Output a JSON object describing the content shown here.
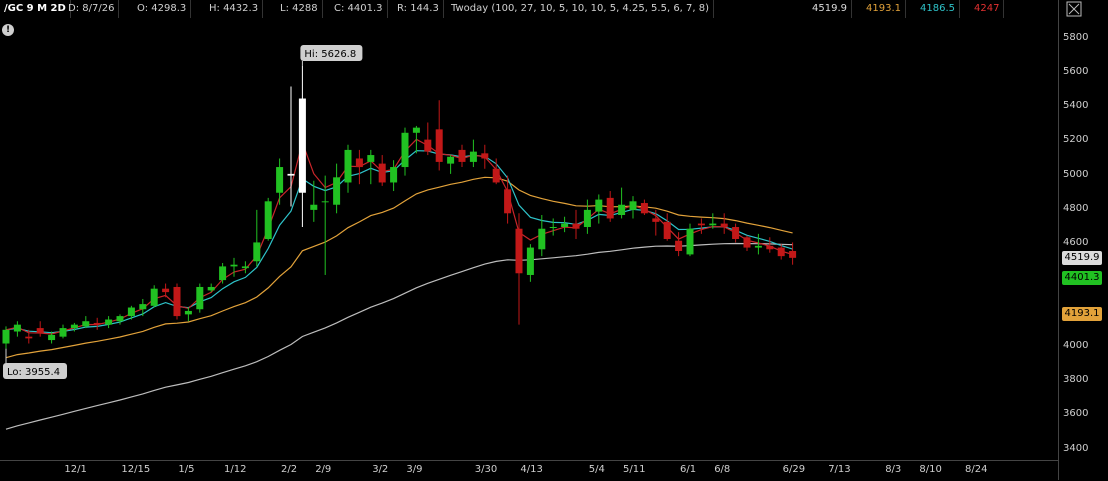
{
  "header": {
    "symbol": "/GC 9 M 2D",
    "date": "D: 8/7/26",
    "open": "O: 4298.3",
    "high": "H: 4432.3",
    "low": "L: 4288",
    "close": "C: 4401.3",
    "range": "R: 144.3",
    "study": "Twoday (100, 27, 10, 5, 10, 10, 5, 4.25, 5.5, 6, 7, 8)",
    "study_values": [
      "4519.9",
      "4193.1",
      "4186.5",
      "4247"
    ]
  },
  "colors": {
    "up": "#21c122",
    "down": "#c21818",
    "spike": "#ffffff",
    "ma_gray": "#bdbdbd",
    "ma_orange": "#e2a23a",
    "ma_cyan": "#2ec3c9",
    "ma_red": "#c9252a",
    "study_val_colors": [
      "#dcdcdc",
      "#e2a23a",
      "#2ec3c9",
      "#e23030"
    ]
  },
  "icons": {
    "alert": "exclamation-circle-icon",
    "settings": "expand-icon"
  },
  "alert_glyph": "!",
  "chart_data": {
    "type": "candlestick",
    "y_ticks": [
      3400,
      3600,
      3800,
      4000,
      4200,
      4400,
      4600,
      4800,
      5000,
      5200,
      5400,
      5600,
      5800
    ],
    "ylim": [
      3340,
      5920
    ],
    "x_ticks": [
      {
        "label": "12/1",
        "i": 6
      },
      {
        "label": "12/15",
        "i": 11
      },
      {
        "label": "1/5",
        "i": 16
      },
      {
        "label": "1/12",
        "i": 20
      },
      {
        "label": "2/2",
        "i": 25
      },
      {
        "label": "2/9",
        "i": 28
      },
      {
        "label": "3/2",
        "i": 33
      },
      {
        "label": "3/9",
        "i": 36
      },
      {
        "label": "3/30",
        "i": 42
      },
      {
        "label": "4/13",
        "i": 46
      },
      {
        "label": "5/4",
        "i": 52
      },
      {
        "label": "5/11",
        "i": 55
      },
      {
        "label": "6/1",
        "i": 60
      },
      {
        "label": "6/8",
        "i": 63
      },
      {
        "label": "6/29",
        "i": 69
      },
      {
        "label": "7/13",
        "i": 73
      },
      {
        "label": "8/3",
        "i": 78
      },
      {
        "label": "8/10",
        "i": 81
      },
      {
        "label": "8/24",
        "i": 85
      }
    ],
    "candles": [
      [
        4020,
        4120,
        3990,
        4100
      ],
      [
        4090,
        4150,
        4060,
        4130
      ],
      [
        4060,
        4100,
        4020,
        4050
      ],
      [
        4110,
        4150,
        4060,
        4080
      ],
      [
        4040,
        4090,
        4020,
        4070
      ],
      [
        4060,
        4130,
        4050,
        4110
      ],
      [
        4110,
        4140,
        4090,
        4130
      ],
      [
        4120,
        4180,
        4110,
        4150
      ],
      [
        4140,
        4170,
        4100,
        4130
      ],
      [
        4130,
        4180,
        4110,
        4160
      ],
      [
        4150,
        4190,
        4130,
        4180
      ],
      [
        4180,
        4240,
        4160,
        4230
      ],
      [
        4220,
        4280,
        4180,
        4250
      ],
      [
        4240,
        4360,
        4230,
        4340
      ],
      [
        4340,
        4370,
        4290,
        4320
      ],
      [
        4350,
        4370,
        4160,
        4180
      ],
      [
        4190,
        4230,
        4150,
        4210
      ],
      [
        4220,
        4370,
        4200,
        4350
      ],
      [
        4330,
        4370,
        4320,
        4350
      ],
      [
        4390,
        4490,
        4370,
        4470
      ],
      [
        4470,
        4520,
        4410,
        4480
      ],
      [
        4460,
        4500,
        4430,
        4470
      ],
      [
        4500,
        4800,
        4470,
        4610
      ],
      [
        4630,
        4870,
        4620,
        4850
      ],
      [
        4900,
        5100,
        4830,
        5050
      ],
      [
        5010,
        5520,
        4820,
        5000
      ],
      [
        4900,
        5640,
        4700,
        5450
      ],
      [
        4800,
        4970,
        4730,
        4830
      ],
      [
        4850,
        5000,
        4420,
        4850
      ],
      [
        4830,
        5070,
        4780,
        4990
      ],
      [
        4960,
        5180,
        4900,
        5150
      ],
      [
        5100,
        5150,
        4950,
        5050
      ],
      [
        5080,
        5150,
        4950,
        5120
      ],
      [
        5070,
        5120,
        4940,
        4960
      ],
      [
        4960,
        5090,
        4910,
        5050
      ],
      [
        5050,
        5280,
        5000,
        5250
      ],
      [
        5250,
        5290,
        5130,
        5280
      ],
      [
        5210,
        5310,
        5120,
        5140
      ],
      [
        5270,
        5440,
        5030,
        5080
      ],
      [
        5070,
        5120,
        5010,
        5110
      ],
      [
        5150,
        5180,
        5050,
        5080
      ],
      [
        5080,
        5210,
        5050,
        5140
      ],
      [
        5130,
        5180,
        5040,
        5100
      ],
      [
        5040,
        5100,
        4950,
        4960
      ],
      [
        4920,
        5000,
        4720,
        4780
      ],
      [
        4690,
        4780,
        4130,
        4430
      ],
      [
        4420,
        4600,
        4380,
        4580
      ],
      [
        4570,
        4770,
        4530,
        4690
      ],
      [
        4700,
        4750,
        4650,
        4700
      ],
      [
        4700,
        4760,
        4670,
        4720
      ],
      [
        4720,
        4800,
        4630,
        4690
      ],
      [
        4700,
        4860,
        4660,
        4800
      ],
      [
        4790,
        4890,
        4720,
        4860
      ],
      [
        4870,
        4910,
        4730,
        4750
      ],
      [
        4770,
        4930,
        4750,
        4830
      ],
      [
        4800,
        4880,
        4750,
        4850
      ],
      [
        4840,
        4860,
        4770,
        4780
      ],
      [
        4750,
        4800,
        4650,
        4730
      ],
      [
        4730,
        4780,
        4620,
        4630
      ],
      [
        4620,
        4670,
        4530,
        4560
      ],
      [
        4540,
        4720,
        4530,
        4690
      ],
      [
        4720,
        4750,
        4660,
        4710
      ],
      [
        4710,
        4780,
        4690,
        4720
      ],
      [
        4720,
        4780,
        4660,
        4700
      ],
      [
        4700,
        4720,
        4610,
        4630
      ],
      [
        4640,
        4650,
        4560,
        4580
      ],
      [
        4580,
        4660,
        4540,
        4590
      ],
      [
        4590,
        4640,
        4550,
        4570
      ],
      [
        4580,
        4600,
        4510,
        4530
      ],
      [
        4560,
        4610,
        4480,
        4520
      ]
    ],
    "annotations": [
      {
        "text": "Hi: 5626.8"
      },
      {
        "text": "Lo: 3955.4"
      }
    ],
    "price_labels": [
      "4519.9",
      "4401.3",
      "4193.1"
    ]
  }
}
